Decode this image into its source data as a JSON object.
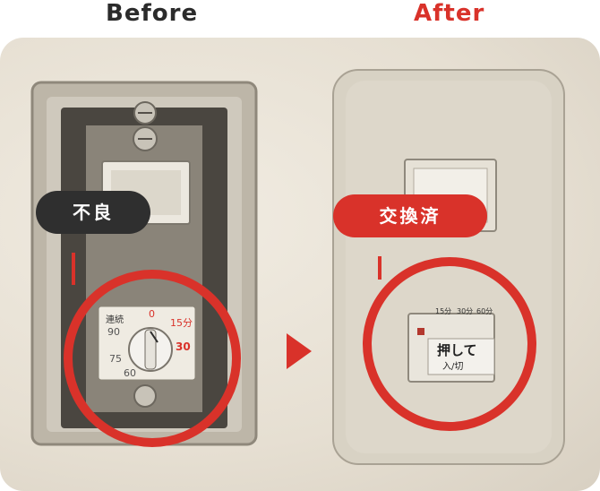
{
  "header": {
    "before": "Before",
    "after": "After"
  },
  "badges": {
    "bad": "不良",
    "replaced": "交換済"
  },
  "old_timer": {
    "mode": "連続",
    "zero": "0",
    "t15": "15分",
    "t30": "30",
    "t60": "60",
    "t90": "90",
    "t75": "75"
  },
  "new_switch": {
    "push": "押して",
    "onoff": "入/切",
    "s15": "15分",
    "s30": "30分",
    "s60": "60分"
  },
  "colors": {
    "accent": "#d9322a",
    "dark": "#2f2f2f"
  }
}
